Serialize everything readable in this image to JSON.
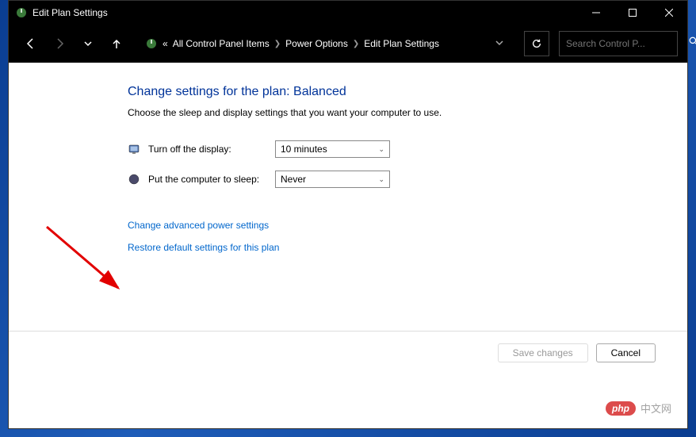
{
  "window": {
    "title": "Edit Plan Settings"
  },
  "breadcrumb": {
    "prefix": "«",
    "items": [
      "All Control Panel Items",
      "Power Options",
      "Edit Plan Settings"
    ]
  },
  "search": {
    "placeholder": "Search Control P..."
  },
  "page": {
    "heading": "Change settings for the plan: Balanced",
    "subtext": "Choose the sleep and display settings that you want your computer to use."
  },
  "settings": {
    "display": {
      "label": "Turn off the display:",
      "value": "10 minutes"
    },
    "sleep": {
      "label": "Put the computer to sleep:",
      "value": "Never"
    }
  },
  "links": {
    "advanced": "Change advanced power settings",
    "restore": "Restore default settings for this plan"
  },
  "buttons": {
    "save": "Save changes",
    "cancel": "Cancel"
  },
  "watermark": {
    "badge": "php",
    "text": "中文网"
  }
}
